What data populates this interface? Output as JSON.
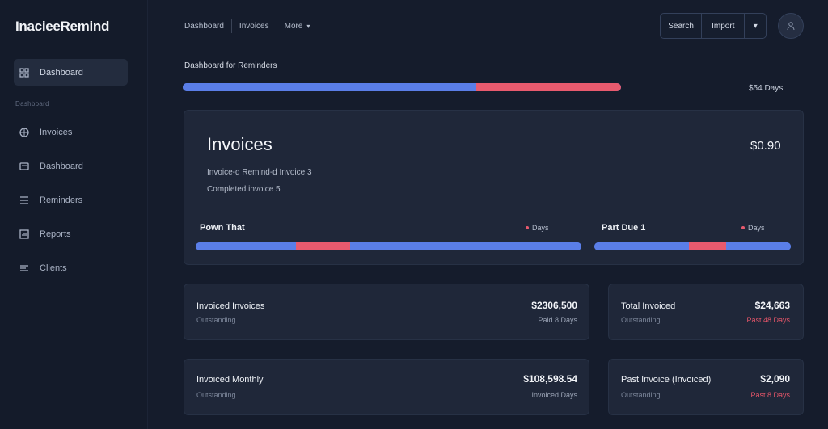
{
  "app": {
    "title": "InacieeRemind"
  },
  "sidebar": {
    "section_label": "Dashboard",
    "items": [
      {
        "label": "Dashboard",
        "icon": "grid-icon",
        "active": true
      },
      {
        "label": "Invoices",
        "icon": "globe-icon"
      },
      {
        "label": "Dashboard",
        "icon": "card-icon"
      },
      {
        "label": "Reminders",
        "icon": "list-icon"
      },
      {
        "label": "Reports",
        "icon": "chart-icon"
      },
      {
        "label": "Clients",
        "icon": "menu-icon"
      }
    ]
  },
  "topnav": {
    "items": [
      "Dashboard",
      "Invoices",
      "More"
    ],
    "more_caret": "▾"
  },
  "toolbar": {
    "btn1": "Search",
    "btn2": "Import",
    "btn3": "▾"
  },
  "overview": {
    "title": "Dashboard for Reminders",
    "progress_paid_pct": 67,
    "progress_overdue_pct": 33,
    "days_label": "$54 Days"
  },
  "invoices_panel": {
    "title": "Invoices",
    "amount": "$0.90",
    "line1": "Invoice-d Remind-d Invoice 3",
    "line2": "Completed invoice 5",
    "sub_left": {
      "title": "Pown That",
      "days": "Days",
      "segments": [
        {
          "pct": 26,
          "color": "#5a7ee8"
        },
        {
          "pct": 14,
          "color": "#e85a6e"
        },
        {
          "pct": 60,
          "color": "#5a7ee8"
        }
      ]
    },
    "sub_right": {
      "title": "Part Due 1",
      "days": "Days",
      "segments": [
        {
          "pct": 48,
          "color": "#5a7ee8"
        },
        {
          "pct": 19,
          "color": "#e85a6e"
        },
        {
          "pct": 33,
          "color": "#5a7ee8"
        }
      ]
    }
  },
  "cards": [
    {
      "title": "Invoiced Invoices",
      "amount": "$2306,500",
      "subtitle": "Outstanding",
      "days": "Paid 8 Days",
      "red": false
    },
    {
      "title": "Total Invoiced",
      "amount": "$24,663",
      "subtitle": "Outstanding",
      "days": "Past 48 Days",
      "red": true
    },
    {
      "title": "Invoiced Monthly",
      "amount": "$108,598.54",
      "subtitle": "Outstanding",
      "days": "Invoiced Days",
      "red": false
    },
    {
      "title": "Past Invoice (Invoiced)",
      "amount": "$2,090",
      "subtitle": "Outstanding",
      "days": "Past 8 Days",
      "red": true
    }
  ],
  "colors": {
    "accent_blue": "#5a7ee8",
    "accent_red": "#e85a6e",
    "background": "#151c2c",
    "panel": "#1f2739"
  }
}
